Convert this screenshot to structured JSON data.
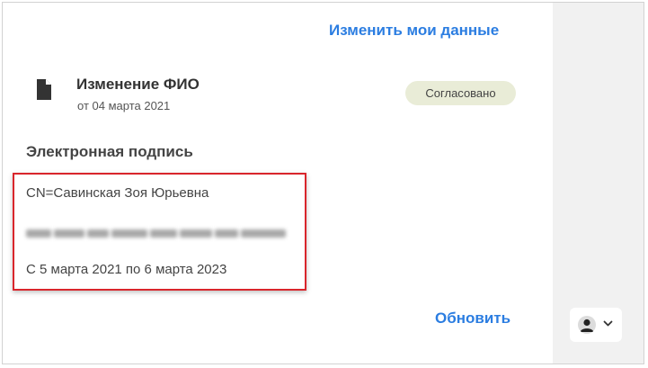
{
  "header": {
    "edit_link": "Изменить мои данные"
  },
  "document": {
    "icon": "file-icon",
    "title": "Изменение ФИО",
    "date": "от 04 марта 2021",
    "status": "Согласовано",
    "status_color": "#e9ecd7"
  },
  "signature": {
    "section_title": "Электронная подпись",
    "owner": "CN=Савинская Зоя Юрьевна",
    "validity": "С 5 марта 2021 по 6 марта 2023",
    "highlight_color": "#d9262c"
  },
  "footer": {
    "refresh_link": "Обновить"
  },
  "user_menu": {
    "icon": "user-icon",
    "dropdown_icon": "chevron-down-icon"
  },
  "colors": {
    "link": "#2b7de1",
    "side_panel": "#f1f1f1"
  }
}
